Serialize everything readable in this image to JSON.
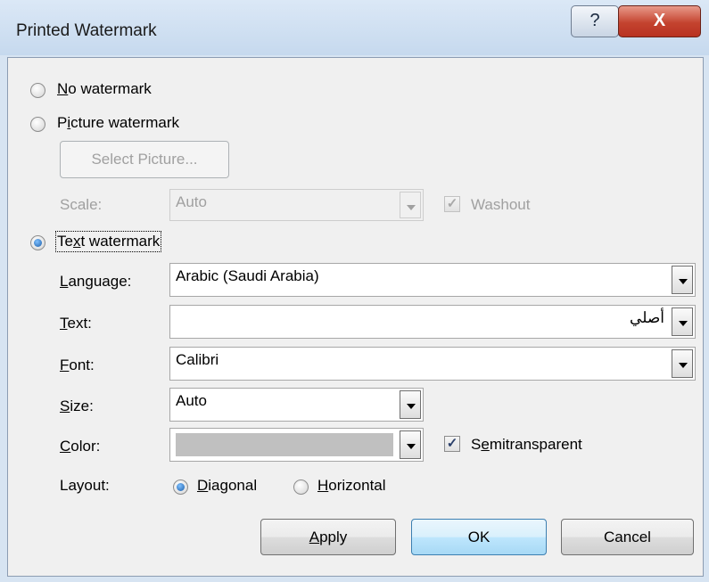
{
  "window": {
    "title": "Printed Watermark",
    "help_label": "?",
    "close_label": "X"
  },
  "options": {
    "no_watermark": "No watermark",
    "picture_watermark": "Picture watermark",
    "text_watermark": "Text watermark",
    "selected": "text_watermark"
  },
  "picture": {
    "select_button": "Select Picture...",
    "scale_label": "Scale:",
    "scale_value": "Auto",
    "washout_label": "Washout",
    "washout_checked": true
  },
  "text_settings": {
    "language_label": "Language:",
    "language_value": "Arabic (Saudi Arabia)",
    "text_label": "Text:",
    "text_value": "أصلي",
    "font_label": "Font:",
    "font_value": "Calibri",
    "size_label": "Size:",
    "size_value": "Auto",
    "color_label": "Color:",
    "color_value": "#c0c0c0",
    "semitransparent_label": "Semitransparent",
    "semitransparent_checked": true,
    "layout_label": "Layout:",
    "layout_diagonal": "Diagonal",
    "layout_horizontal": "Horizontal",
    "layout_selected": "diagonal"
  },
  "buttons": {
    "apply": "Apply",
    "ok": "OK",
    "cancel": "Cancel"
  },
  "icons": {
    "check": "✓"
  }
}
